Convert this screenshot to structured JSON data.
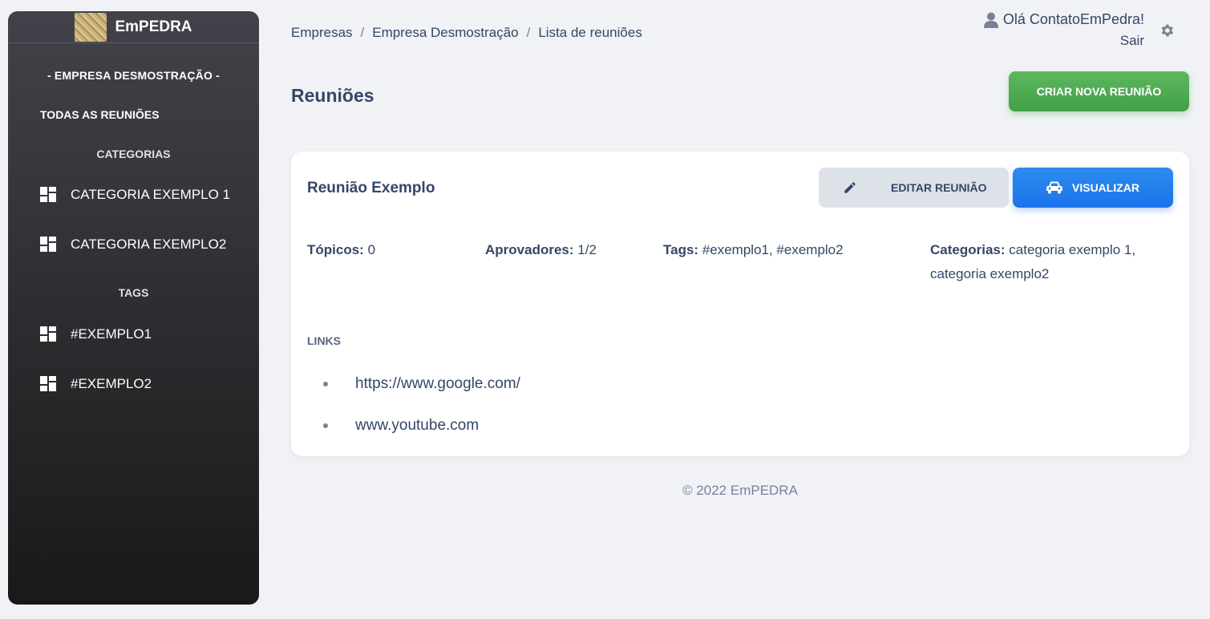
{
  "sidebar": {
    "brand": "EmPEDRA",
    "company": "- EMPRESA DESMOSTRAÇÃO -",
    "all_meetings": "TODAS AS REUNIÕES",
    "categories_title": "CATEGORIAS",
    "categories": [
      {
        "label": "CATEGORIA EXEMPLO 1",
        "icon": "dashboard-icon"
      },
      {
        "label": "CATEGORIA EXEMPLO2",
        "icon": "dashboard-icon"
      }
    ],
    "tags_title": "TAGS",
    "tags": [
      {
        "label": "#EXEMPLO1",
        "icon": "dashboard-icon"
      },
      {
        "label": "#EXEMPLO2",
        "icon": "dashboard-icon"
      }
    ]
  },
  "breadcrumb": {
    "items": [
      "Empresas",
      "Empresa Desmostração",
      "Lista de reuniões"
    ],
    "separator": "/"
  },
  "user": {
    "greeting": "Olá ContatoEmPedra!",
    "logout": "Sair"
  },
  "page": {
    "title": "Reuniões",
    "create_button": "CRIAR NOVA REUNIÃO"
  },
  "meeting": {
    "title": "Reunião Exemplo",
    "edit_button": "EDITAR REUNIÃO",
    "view_button": "VISUALIZAR",
    "topics_label": "Tópicos:",
    "topics_value": "0",
    "approvers_label": "Aprovadores:",
    "approvers_value": "1/2",
    "tags_label": "Tags:",
    "tags_value": "#exemplo1, #exemplo2",
    "categories_label": "Categorias:",
    "categories_value_line1": "categoria exemplo 1,",
    "categories_value_line2": "categoria exemplo2",
    "links_title": "LINKS",
    "links": [
      "https://www.google.com/",
      "www.youtube.com"
    ]
  },
  "footer": "© 2022 EmPEDRA",
  "colors": {
    "accent_green": "#4caf50",
    "accent_blue": "#1a73e8",
    "text": "#344767",
    "sidebar_dark": "#191919"
  }
}
